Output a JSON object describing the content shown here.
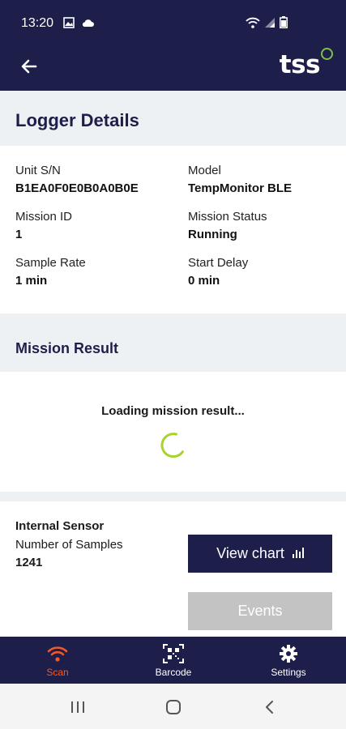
{
  "status_bar": {
    "time": "13:20"
  },
  "app_bar": {
    "logo_text": "tss"
  },
  "page": {
    "title": "Logger Details"
  },
  "details": {
    "unit_sn_label": "Unit S/N",
    "unit_sn_value": "B1EA0F0E0B0A0B0E",
    "model_label": "Model",
    "model_value": "TempMonitor BLE",
    "mission_id_label": "Mission ID",
    "mission_id_value": "1",
    "mission_status_label": "Mission Status",
    "mission_status_value": "Running",
    "sample_rate_label": "Sample Rate",
    "sample_rate_value": "1 min",
    "start_delay_label": "Start Delay",
    "start_delay_value": "0 min"
  },
  "mission_result": {
    "title": "Mission Result",
    "loading_text": "Loading mission result..."
  },
  "sensor": {
    "name": "Internal Sensor",
    "samples_label": "Number of Samples",
    "samples_value": "1241",
    "view_chart_label": "View chart",
    "events_label": "Events"
  },
  "bottom_nav": {
    "items": [
      {
        "label": "Scan",
        "icon": "wifi-icon",
        "active": true
      },
      {
        "label": "Barcode",
        "icon": "qr-code-icon",
        "active": false
      },
      {
        "label": "Settings",
        "icon": "gear-icon",
        "active": false
      }
    ]
  },
  "colors": {
    "primary": "#1e1e4b",
    "accent_active": "#f05a28",
    "spinner": "#a8d42a",
    "band": "#eef1f4",
    "disabled": "#c3c3c3"
  }
}
